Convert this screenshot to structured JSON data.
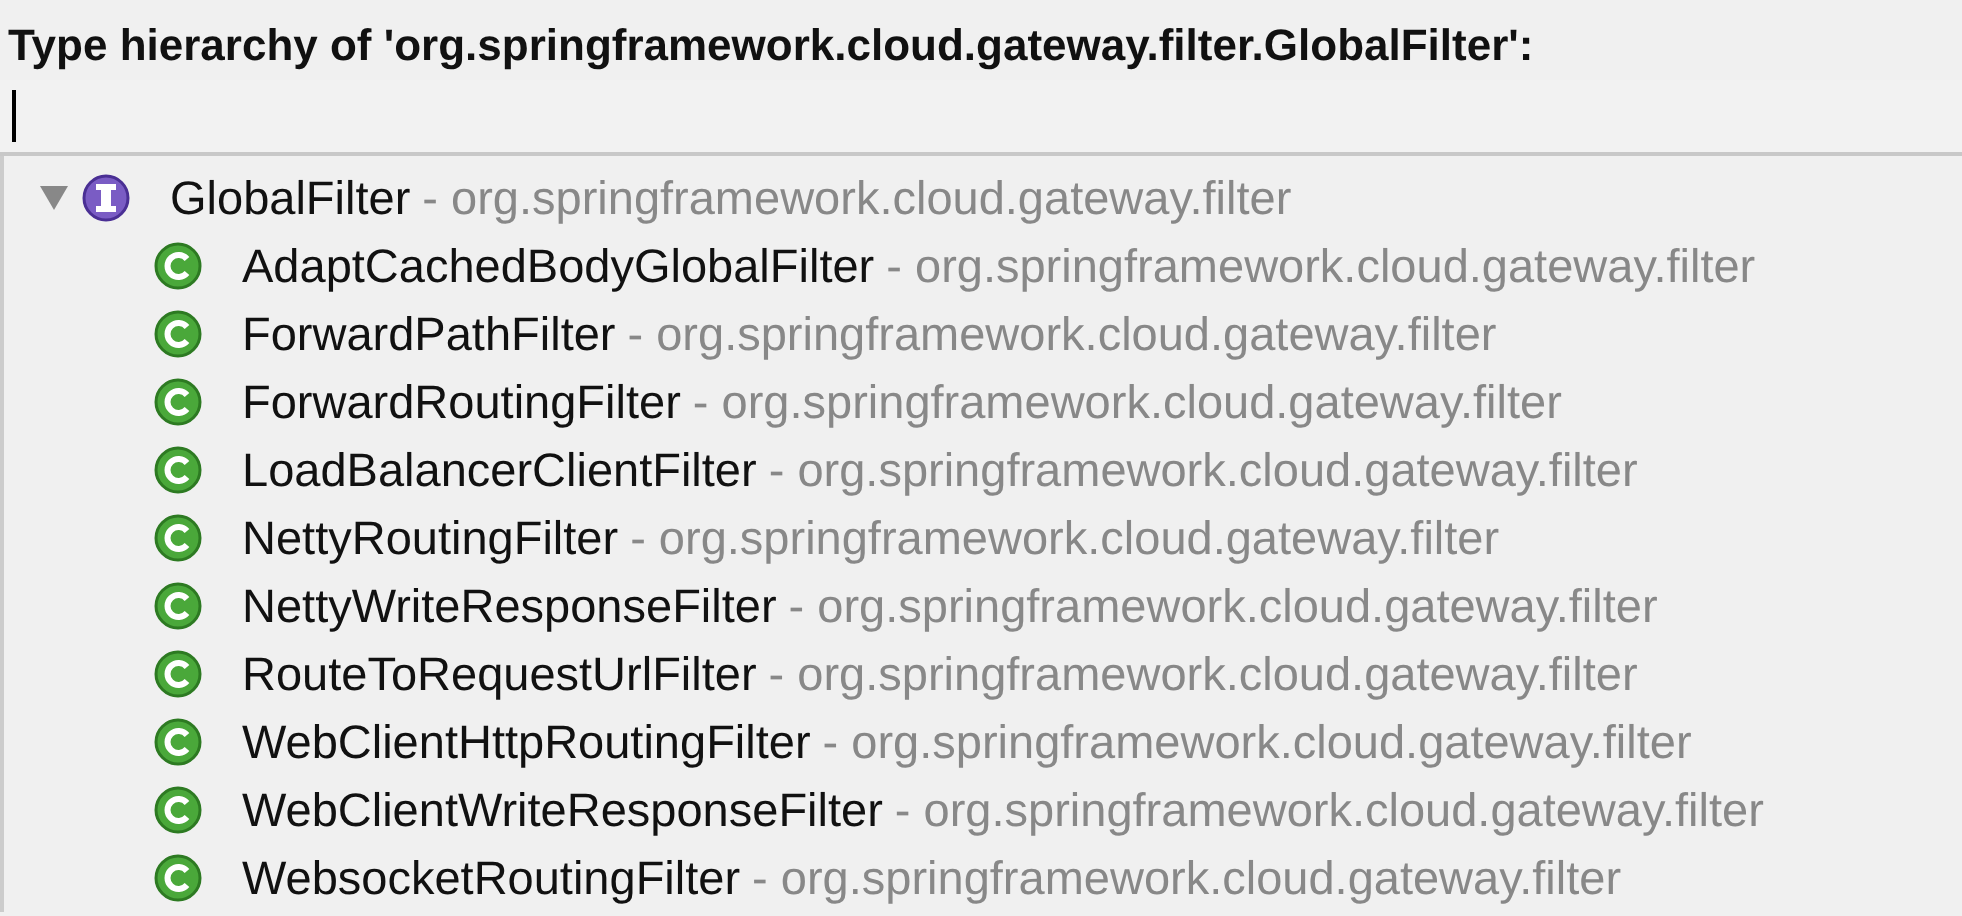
{
  "title": "Type hierarchy of 'org.springframework.cloud.gateway.filter.GlobalFilter':",
  "tree": [
    {
      "kind": "interface",
      "name": "GlobalFilter",
      "package": "- org.springframework.cloud.gateway.filter",
      "expanded": true,
      "children": [
        {
          "kind": "class",
          "name": "AdaptCachedBodyGlobalFilter",
          "package": "- org.springframework.cloud.gateway.filter"
        },
        {
          "kind": "class",
          "name": "ForwardPathFilter",
          "package": "- org.springframework.cloud.gateway.filter"
        },
        {
          "kind": "class",
          "name": "ForwardRoutingFilter",
          "package": "- org.springframework.cloud.gateway.filter"
        },
        {
          "kind": "class",
          "name": "LoadBalancerClientFilter",
          "package": "- org.springframework.cloud.gateway.filter"
        },
        {
          "kind": "class",
          "name": "NettyRoutingFilter",
          "package": "- org.springframework.cloud.gateway.filter"
        },
        {
          "kind": "class",
          "name": "NettyWriteResponseFilter",
          "package": "- org.springframework.cloud.gateway.filter"
        },
        {
          "kind": "class",
          "name": "RouteToRequestUrlFilter",
          "package": "- org.springframework.cloud.gateway.filter"
        },
        {
          "kind": "class",
          "name": "WebClientHttpRoutingFilter",
          "package": "- org.springframework.cloud.gateway.filter"
        },
        {
          "kind": "class",
          "name": "WebClientWriteResponseFilter",
          "package": "- org.springframework.cloud.gateway.filter"
        },
        {
          "kind": "class",
          "name": "WebsocketRoutingFilter",
          "package": "- org.springframework.cloud.gateway.filter"
        }
      ]
    }
  ]
}
